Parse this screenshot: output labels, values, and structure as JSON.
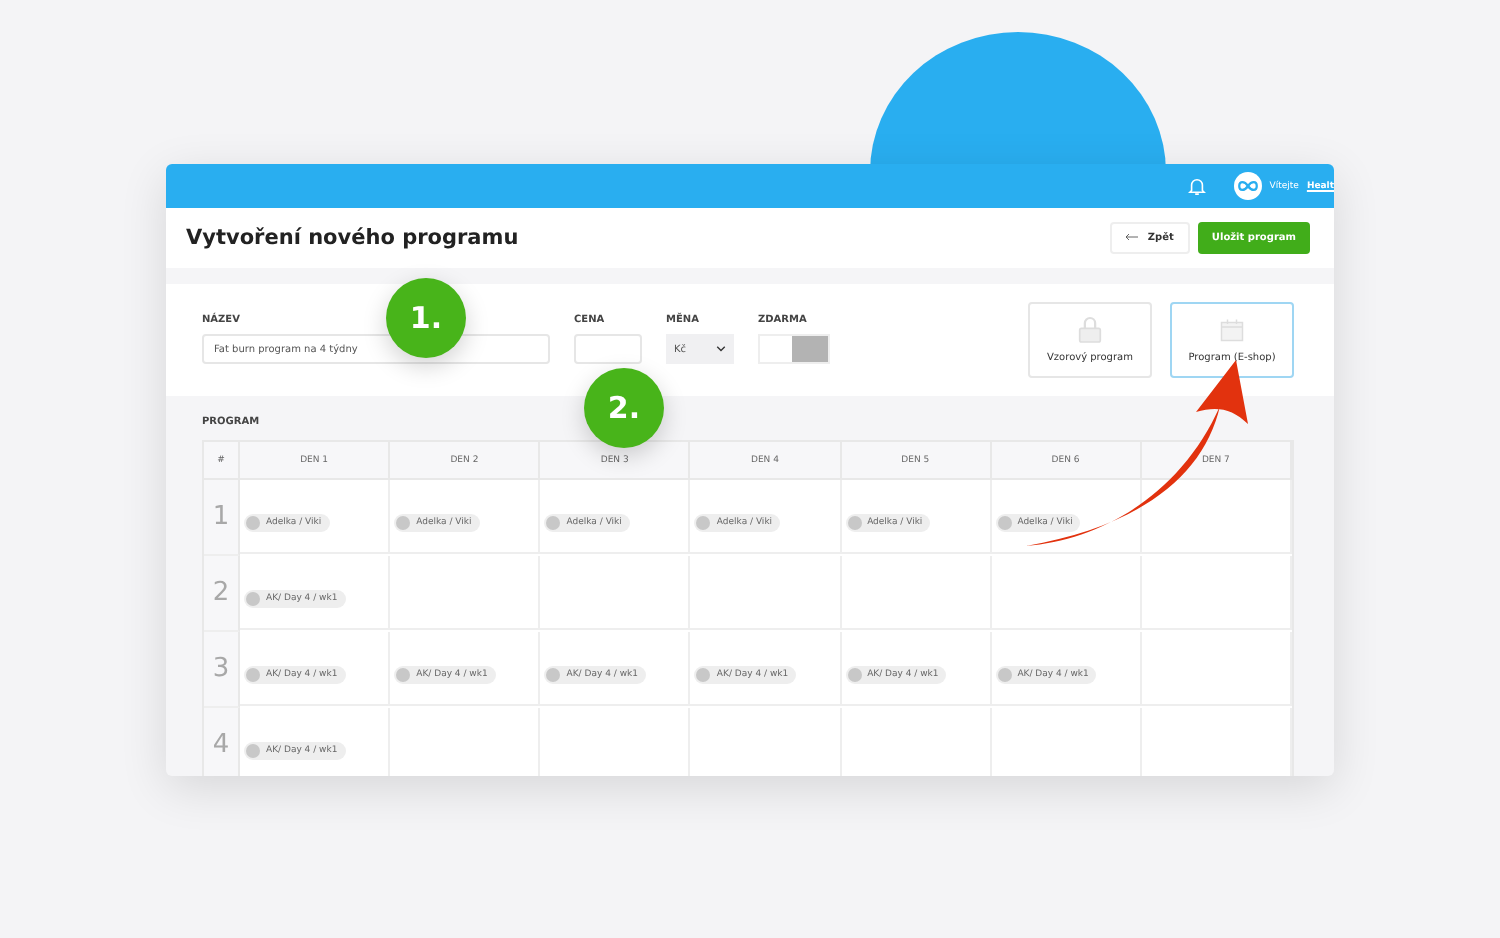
{
  "topbar": {
    "greeting": "Vítejte",
    "user_link": "Healt"
  },
  "header": {
    "title": "Vytvoření nového programu",
    "back_button": "Zpět",
    "save_button": "Uložit program"
  },
  "form": {
    "name_label": "NÁZEV",
    "name_value": "Fat burn program na 4 týdny",
    "price_label": "CENA",
    "currency_label": "MĚNA",
    "currency_value": "Kč",
    "free_label": "ZDARMA",
    "free_on": false
  },
  "options": [
    {
      "label": "Vzorový program",
      "kind": "lock",
      "selected": false
    },
    {
      "label": "Program (E-shop)",
      "kind": "calendar",
      "selected": true
    }
  ],
  "steps": [
    "1.",
    "2."
  ],
  "program": {
    "label": "PROGRAM",
    "columns": [
      "#",
      "DEN 1",
      "DEN 2",
      "DEN 3",
      "DEN 4",
      "DEN 5",
      "DEN 6",
      "DEN 7"
    ],
    "rows": [
      {
        "cells": [
          "1",
          [
            "Adelka / Viki"
          ],
          [
            "Adelka / Viki"
          ],
          [
            "Adelka / Viki"
          ],
          [
            "Adelka / Viki"
          ],
          [
            "Adelka / Viki"
          ],
          [
            "Adelka / Viki"
          ],
          []
        ]
      },
      {
        "cells": [
          "2",
          [
            "AK/ Day 4 / wk1"
          ],
          [],
          [],
          [],
          [],
          [],
          []
        ]
      },
      {
        "cells": [
          "3",
          [
            "AK/ Day 4 / wk1"
          ],
          [
            "AK/ Day 4 / wk1"
          ],
          [
            "AK/ Day 4 / wk1"
          ],
          [
            "AK/ Day 4 / wk1"
          ],
          [
            "AK/ Day 4 / wk1"
          ],
          [
            "AK/ Day 4 / wk1"
          ],
          []
        ]
      },
      {
        "cells": [
          "4",
          [
            "AK/ Day 4 / wk1"
          ],
          [],
          [],
          [],
          [],
          [],
          []
        ]
      }
    ]
  }
}
